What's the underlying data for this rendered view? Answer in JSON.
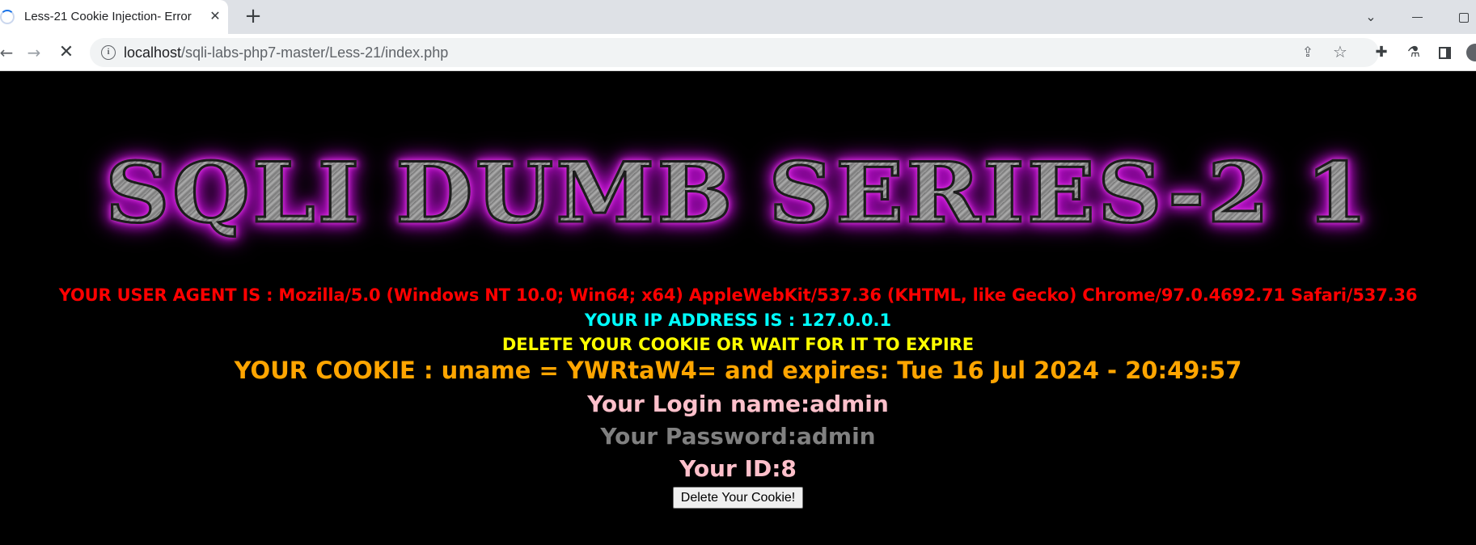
{
  "browser": {
    "tab": {
      "title": "Less-21 Cookie Injection- Error"
    },
    "address_bar": {
      "host": "localhost",
      "path": "/sqli-labs-php7-master/Less-21/index.php"
    },
    "icons": {
      "tab_loading": "loading-spinner-icon",
      "tab_close": "close-icon",
      "new_tab": "plus-icon",
      "back": "arrow-left-icon",
      "forward": "arrow-right-icon",
      "stop": "stop-loading-icon",
      "site_info": "info-icon",
      "share": "share-icon",
      "bookmark": "star-icon",
      "extensions": "puzzle-icon",
      "labs": "flask-icon",
      "side_panel": "side-panel-icon",
      "profile": "profile-icon"
    }
  },
  "page": {
    "banner": "SQLI DUMB SERIES-2 1",
    "user_agent": "YOUR USER AGENT IS : Mozilla/5.0 (Windows NT 10.0; Win64; x64) AppleWebKit/537.36 (KHTML, like Gecko) Chrome/97.0.4692.71 Safari/537.36",
    "ip_address": "YOUR IP ADDRESS IS : 127.0.0.1",
    "delete_message": "DELETE YOUR COOKIE OR WAIT FOR IT TO EXPIRE",
    "cookie": "YOUR COOKIE : uname = YWRtaW4= and expires: Tue 16 Jul 2024 - 20:49:57",
    "login_name": "Your Login name:admin",
    "password": "Your Password:admin",
    "user_id": "Your ID:8",
    "delete_button": "Delete Your Cookie!"
  },
  "colors": {
    "user_agent": "#ff0000",
    "ip_address": "#00ffff",
    "delete_message": "#ffff00",
    "cookie": "#ffa500",
    "login_name": "#ffc0cb",
    "password": "#808080",
    "user_id": "#ffc0cb",
    "banner_glow": "#c010cf",
    "background": "#000000"
  }
}
